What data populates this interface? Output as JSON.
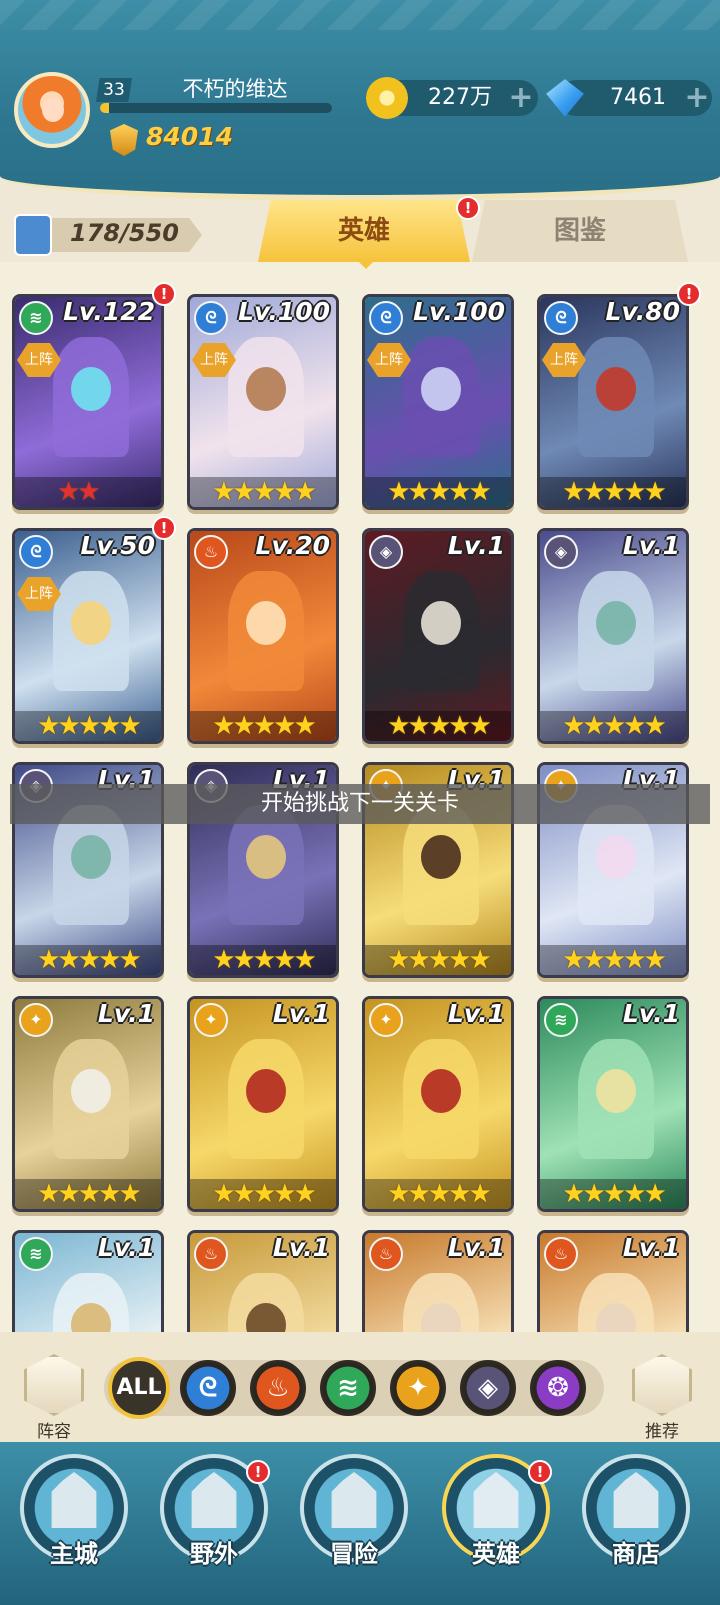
{
  "header": {
    "player_level": "33",
    "player_name": "不朽的维达",
    "exp_percent": 4,
    "power_value": "84014",
    "gold_value": "227万",
    "gem_value": "7461",
    "plus_glyph": "+"
  },
  "collection": {
    "count_text": "178/550"
  },
  "tabs": {
    "heroes": "英雄",
    "codex": "图鉴"
  },
  "alert_glyph": "!",
  "deploy_label": "上阵",
  "heroes": [
    {
      "level": "Lv.122",
      "element": "wind",
      "deployed": true,
      "stars": "★★",
      "star_color": "red",
      "alert": true,
      "colors": [
        "#3a2c6e",
        "#8f6cd8",
        "#6fe2f0"
      ]
    },
    {
      "level": "Lv.100",
      "element": "water",
      "deployed": true,
      "stars": "★★★★★",
      "star_color": "gold",
      "alert": false,
      "colors": [
        "#9fa9d8",
        "#f1e3ec",
        "#b47c53"
      ]
    },
    {
      "level": "Lv.100",
      "element": "water",
      "deployed": true,
      "stars": "★★★★★",
      "star_color": "gold",
      "alert": false,
      "colors": [
        "#2d6e8a",
        "#6a4fb0",
        "#cdd2f5"
      ]
    },
    {
      "level": "Lv.80",
      "element": "water",
      "deployed": true,
      "stars": "★★★★★",
      "star_color": "gold",
      "alert": true,
      "colors": [
        "#2a355c",
        "#6f8ab5",
        "#c23a2a"
      ]
    },
    {
      "level": "Lv.50",
      "element": "water",
      "deployed": true,
      "stars": "★★★★★",
      "star_color": "gold",
      "alert": true,
      "colors": [
        "#3b5f8f",
        "#cfe0ef",
        "#f5d37a"
      ]
    },
    {
      "level": "Lv.20",
      "element": "fire",
      "deployed": false,
      "stars": "★★★★★",
      "star_color": "gold",
      "alert": false,
      "colors": [
        "#b8481a",
        "#f1893a",
        "#fde1b7"
      ]
    },
    {
      "level": "Lv.1",
      "element": "dark",
      "deployed": false,
      "stars": "★★★★★",
      "star_color": "gold",
      "alert": false,
      "colors": [
        "#5e1a22",
        "#2a2a30",
        "#e5e0d5"
      ]
    },
    {
      "level": "Lv.1",
      "element": "dark",
      "deployed": false,
      "stars": "★★★★★",
      "star_color": "gold",
      "alert": false,
      "colors": [
        "#4a4a8c",
        "#c8d8ea",
        "#78b4a7"
      ]
    },
    {
      "level": "Lv.1",
      "element": "dark",
      "deployed": false,
      "stars": "★★★★★",
      "star_color": "gold",
      "alert": false,
      "colors": [
        "#3f4a87",
        "#c7d6e8",
        "#79b4a6"
      ]
    },
    {
      "level": "Lv.1",
      "element": "dark",
      "deployed": false,
      "stars": "★★★★★",
      "star_color": "gold",
      "alert": false,
      "colors": [
        "#2f2d56",
        "#7a72b8",
        "#e3c67e"
      ]
    },
    {
      "level": "Lv.1",
      "element": "light",
      "deployed": false,
      "stars": "★★★★★",
      "star_color": "gold",
      "alert": false,
      "colors": [
        "#b68a1e",
        "#f6dd7a",
        "#4a2e1e"
      ]
    },
    {
      "level": "Lv.1",
      "element": "light",
      "deployed": false,
      "stars": "★★★★★",
      "star_color": "gold",
      "alert": false,
      "colors": [
        "#7e8dc4",
        "#dfe6f4",
        "#f2d9ef"
      ]
    },
    {
      "level": "Lv.1",
      "element": "light",
      "deployed": false,
      "stars": "★★★★★",
      "star_color": "gold",
      "alert": false,
      "colors": [
        "#8e7b3e",
        "#e6d29a",
        "#f1efe8"
      ]
    },
    {
      "level": "Lv.1",
      "element": "light",
      "deployed": false,
      "stars": "★★★★★",
      "star_color": "gold",
      "alert": false,
      "colors": [
        "#c59422",
        "#f6d86a",
        "#b32a20"
      ]
    },
    {
      "level": "Lv.1",
      "element": "light",
      "deployed": false,
      "stars": "★★★★★",
      "star_color": "gold",
      "alert": false,
      "colors": [
        "#c59422",
        "#f6d86a",
        "#b32a20"
      ]
    },
    {
      "level": "Lv.1",
      "element": "wind",
      "deployed": false,
      "stars": "★★★★★",
      "star_color": "gold",
      "alert": false,
      "colors": [
        "#2c8a5c",
        "#9fe2b5",
        "#f0e2a0"
      ]
    },
    {
      "level": "Lv.1",
      "element": "wind",
      "deployed": false,
      "stars": "",
      "star_color": "gold",
      "alert": false,
      "colors": [
        "#7bb6d2",
        "#e9f2f6",
        "#d8b772"
      ]
    },
    {
      "level": "Lv.1",
      "element": "fire",
      "deployed": false,
      "stars": "",
      "star_color": "gold",
      "alert": false,
      "colors": [
        "#c79a3a",
        "#f3dca0",
        "#6c4a28"
      ]
    },
    {
      "level": "Lv.1",
      "element": "fire",
      "deployed": false,
      "stars": "",
      "star_color": "gold",
      "alert": false,
      "colors": [
        "#c77a2c",
        "#f8e2b8",
        "#e9d4c0"
      ]
    },
    {
      "level": "Lv.1",
      "element": "fire",
      "deployed": false,
      "stars": "",
      "star_color": "gold",
      "alert": false,
      "colors": [
        "#c77a2c",
        "#f8e2b8",
        "#e9d4c0"
      ]
    }
  ],
  "element_styles": {
    "wind": {
      "color": "#2fa85a",
      "glyph": "≋"
    },
    "water": {
      "color": "#2f7fd6",
      "glyph": "ᘓ"
    },
    "fire": {
      "color": "#e0561f",
      "glyph": "♨"
    },
    "dark": {
      "color": "#5a5378",
      "glyph": "◈"
    },
    "light": {
      "color": "#e8a21c",
      "glyph": "✦"
    },
    "arcane": {
      "color": "#8a3cc4",
      "glyph": "❂"
    }
  },
  "toast": "开始挑战下一关关卡",
  "filters": {
    "lineup_label": "阵容",
    "recommend_label": "推荐",
    "all_label": "ALL",
    "items": [
      {
        "name": "water",
        "glyph": "ᘓ",
        "color": "#2f7fd6"
      },
      {
        "name": "fire",
        "glyph": "♨",
        "color": "#e0561f"
      },
      {
        "name": "wind",
        "glyph": "≋",
        "color": "#2fa85a"
      },
      {
        "name": "light",
        "glyph": "✦",
        "color": "#e8a21c"
      },
      {
        "name": "dark",
        "glyph": "◈",
        "color": "#5a5378"
      },
      {
        "name": "arcane",
        "glyph": "❂",
        "color": "#8a3cc4"
      }
    ]
  },
  "nav": [
    {
      "label": "主城",
      "icon": "castle-icon",
      "alert": false,
      "active": false
    },
    {
      "label": "野外",
      "icon": "portal-icon",
      "alert": true,
      "active": false
    },
    {
      "label": "冒险",
      "icon": "sword-icon",
      "alert": false,
      "active": false
    },
    {
      "label": "英雄",
      "icon": "knight-helmet-icon",
      "alert": true,
      "active": true
    },
    {
      "label": "商店",
      "icon": "shop-icon",
      "alert": false,
      "active": false
    }
  ]
}
